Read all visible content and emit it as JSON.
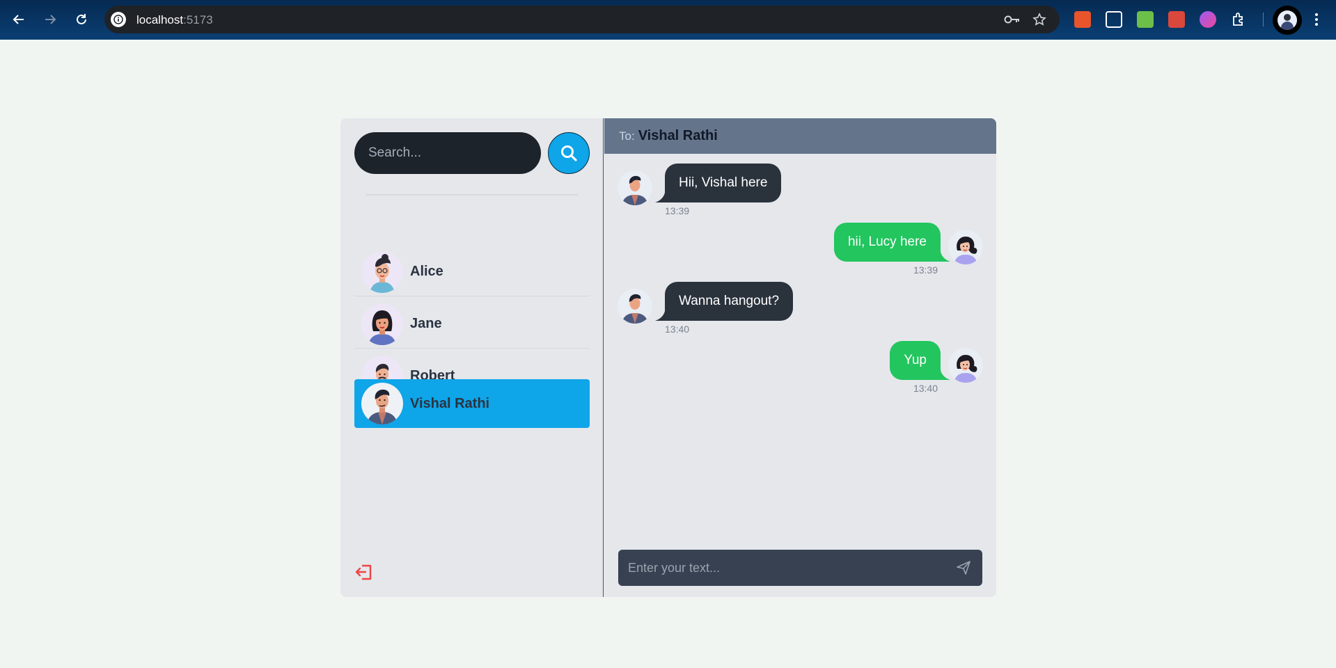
{
  "browser": {
    "url_host": "localhost",
    "url_port": ":5173",
    "icons": [
      "back-icon",
      "forward-icon",
      "reload-icon",
      "site-info-icon",
      "password-key-icon",
      "bookmark-star-icon",
      "extensions-icon",
      "profile-avatar",
      "menu-icon"
    ]
  },
  "sidebar": {
    "search_placeholder": "Search...",
    "contacts": [
      {
        "name": "Alice",
        "active": false
      },
      {
        "name": "Jane",
        "active": false
      },
      {
        "name": "Robert",
        "active": false
      },
      {
        "name": "Vishal Rathi",
        "active": true
      }
    ]
  },
  "chat": {
    "to_label": "To:",
    "to_name": "Vishal Rathi",
    "messages": [
      {
        "text": "Hii, Vishal here",
        "time": "13:39",
        "direction": "received"
      },
      {
        "text": "hii, Lucy here",
        "time": "13:39",
        "direction": "sent"
      },
      {
        "text": "Wanna hangout?",
        "time": "13:40",
        "direction": "received"
      },
      {
        "text": "Yup",
        "time": "13:40",
        "direction": "sent"
      }
    ],
    "composer_placeholder": "Enter your text..."
  },
  "colors": {
    "accent": "#0ea5e9",
    "sent_bubble": "#22c55e",
    "received_bubble": "#2a323c",
    "header": "#64748b",
    "logout": "#ef4444"
  }
}
